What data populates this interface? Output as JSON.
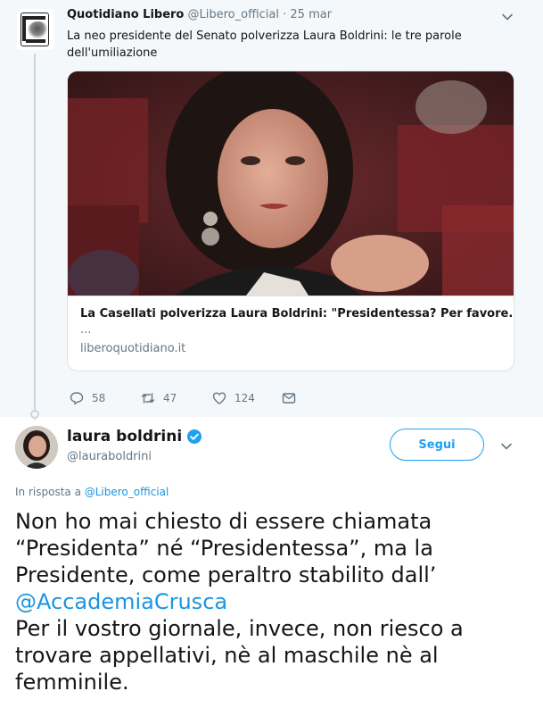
{
  "parent_tweet": {
    "author_name": "Quotidiano Libero",
    "handle": "@Libero_official",
    "separator": " · ",
    "date": "25 mar",
    "text": "La neo presidente del Senato polverizza Laura Boldrini: le tre parole dell'umiliazione",
    "card": {
      "title": "La Casellati polverizza Laura Boldrini: \"Presidentessa? Per favore...\"",
      "ellipsis": "...",
      "domain": "liberoquotidiano.it"
    },
    "replies": "58",
    "retweets": "47",
    "likes": "124"
  },
  "main_tweet": {
    "author_name": "laura boldrini",
    "handle": "@lauraboldrini",
    "follow_label": "Segui",
    "reply_prefix": "In risposta a ",
    "reply_mention": "@Libero_official",
    "text_part1": "Non ho mai chiesto di essere chiamata “Presidenta” né “Presidentessa”, ma la Presidente, come peraltro stabilito dall’",
    "text_mention": "@AccademiaCrusca",
    "text_part2": "Per il vostro giornale, invece, non riesco a trovare appellativi, nè al maschile nè al femminile."
  },
  "colors": {
    "accent": "#1da1f2",
    "link": "#1b95e0",
    "muted": "#657786",
    "parent_bg": "#f5f8fa"
  },
  "icons": [
    "chevron-down-icon",
    "reply-icon",
    "retweet-icon",
    "like-icon",
    "direct-message-icon",
    "verified-badge-icon"
  ]
}
